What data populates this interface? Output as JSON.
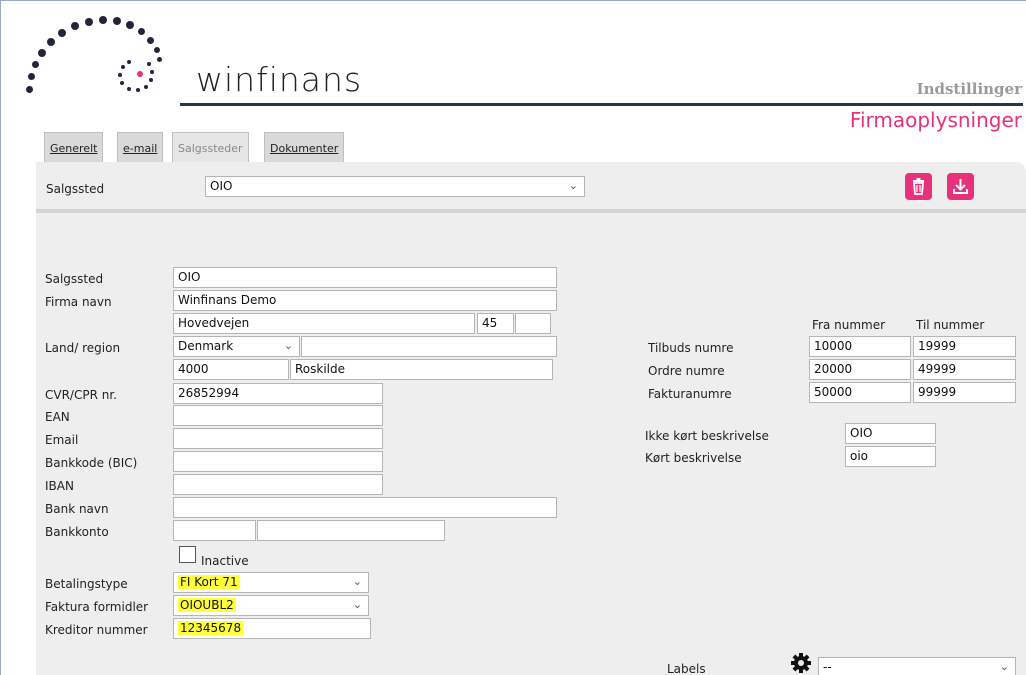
{
  "app": {
    "logo_text": "winfinans",
    "section": "Indstillinger",
    "page_title": "Firmaoplysninger"
  },
  "tabs": [
    "Generelt",
    "e-mail",
    "Salgssteder",
    "Dokumenter"
  ],
  "active_tab": "Salgssteder",
  "selector": {
    "label": "Salgssted",
    "value": "OIO"
  },
  "actions": {
    "delete_icon": "trash-icon",
    "download_icon": "download-icon"
  },
  "form": {
    "salgssted": {
      "label": "Salgssted",
      "value": "OIO"
    },
    "firma_navn": {
      "label": "Firma navn",
      "value": "Winfinans Demo"
    },
    "address": {
      "street": "Hovedvejen",
      "number": "45",
      "extra": ""
    },
    "land": {
      "label": "Land/ region",
      "value": "Denmark",
      "extra": ""
    },
    "postal": {
      "zip": "4000",
      "city": "Roskilde"
    },
    "cvr": {
      "label": "CVR/CPR nr.",
      "value": "26852994"
    },
    "ean": {
      "label": "EAN",
      "value": ""
    },
    "email": {
      "label": "Email",
      "value": ""
    },
    "bankkode": {
      "label": "Bankkode (BIC)",
      "value": ""
    },
    "iban": {
      "label": "IBAN",
      "value": ""
    },
    "bank_navn": {
      "label": "Bank navn",
      "value": ""
    },
    "bankkonto": {
      "label": "Bankkonto",
      "reg": "",
      "account": ""
    },
    "inactive": {
      "label": "Inactive",
      "checked": false
    },
    "betalingstype": {
      "label": "Betalingstype",
      "value": "FI Kort 71"
    },
    "faktura_formidler": {
      "label": "Faktura formidler",
      "value": "OIOUBL2"
    },
    "kreditor_nummer": {
      "label": "Kreditor nummer",
      "value": "12345678"
    }
  },
  "numbers": {
    "col_from": "Fra nummer",
    "col_to": "Til nummer",
    "rows": [
      {
        "label": "Tilbuds numre",
        "from": "10000",
        "to": "19999"
      },
      {
        "label": "Ordre numre",
        "from": "20000",
        "to": "49999"
      },
      {
        "label": "Fakturanumre",
        "from": "50000",
        "to": "99999"
      }
    ]
  },
  "descriptions": {
    "ikke_kort": {
      "label": "Ikke kørt beskrivelse",
      "value": "OIO"
    },
    "kort": {
      "label": "Kørt beskrivelse",
      "value": "oio"
    }
  },
  "labels": {
    "label": "Labels",
    "value": "--",
    "icon": "gear-icon"
  },
  "colors": {
    "accent": "#e8317b",
    "highlight": "#ffff3c",
    "header_line": "#1f3a4a"
  }
}
